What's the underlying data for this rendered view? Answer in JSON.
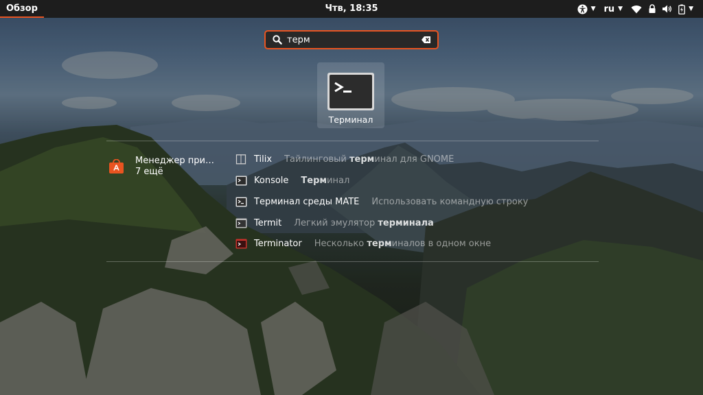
{
  "topbar": {
    "activities_label": "Обзор",
    "clock": "Чтв, 18:35",
    "language": "ru",
    "tray_icons": [
      "accessibility-icon",
      "wifi-icon",
      "lock-icon",
      "volume-icon",
      "battery-icon"
    ]
  },
  "search": {
    "value": "терм",
    "placeholder": ""
  },
  "app_result": {
    "label": "Терминал",
    "icon": "terminal-icon"
  },
  "provider": {
    "name": "Менеджер при…",
    "more": "7 ещё",
    "icon": "software-center-icon"
  },
  "results": [
    {
      "name": "Tilix",
      "desc_pre": "Тайлинговый ",
      "desc_match": "терм",
      "desc_post": "инал для GNOME",
      "icon": "tilix-icon"
    },
    {
      "name": "Konsole",
      "desc_pre": "",
      "desc_match": "Терм",
      "desc_post": "инал",
      "icon": "konsole-icon"
    },
    {
      "name": "Терминал среды MATE",
      "desc_pre": "Использовать командную строку",
      "desc_match": "",
      "desc_post": "",
      "icon": "mate-terminal-icon"
    },
    {
      "name": "Termit",
      "desc_pre": "Легкий эмулятор ",
      "desc_match": "терминала",
      "desc_post": "",
      "icon": "termit-icon"
    },
    {
      "name": "Terminator",
      "desc_pre": "Несколько ",
      "desc_match": "терм",
      "desc_post": "иналов в одном окне",
      "icon": "terminator-icon"
    }
  ],
  "colors": {
    "accent": "#e95420",
    "topbar": "#1d1d1d",
    "search_bg": "#282828"
  }
}
